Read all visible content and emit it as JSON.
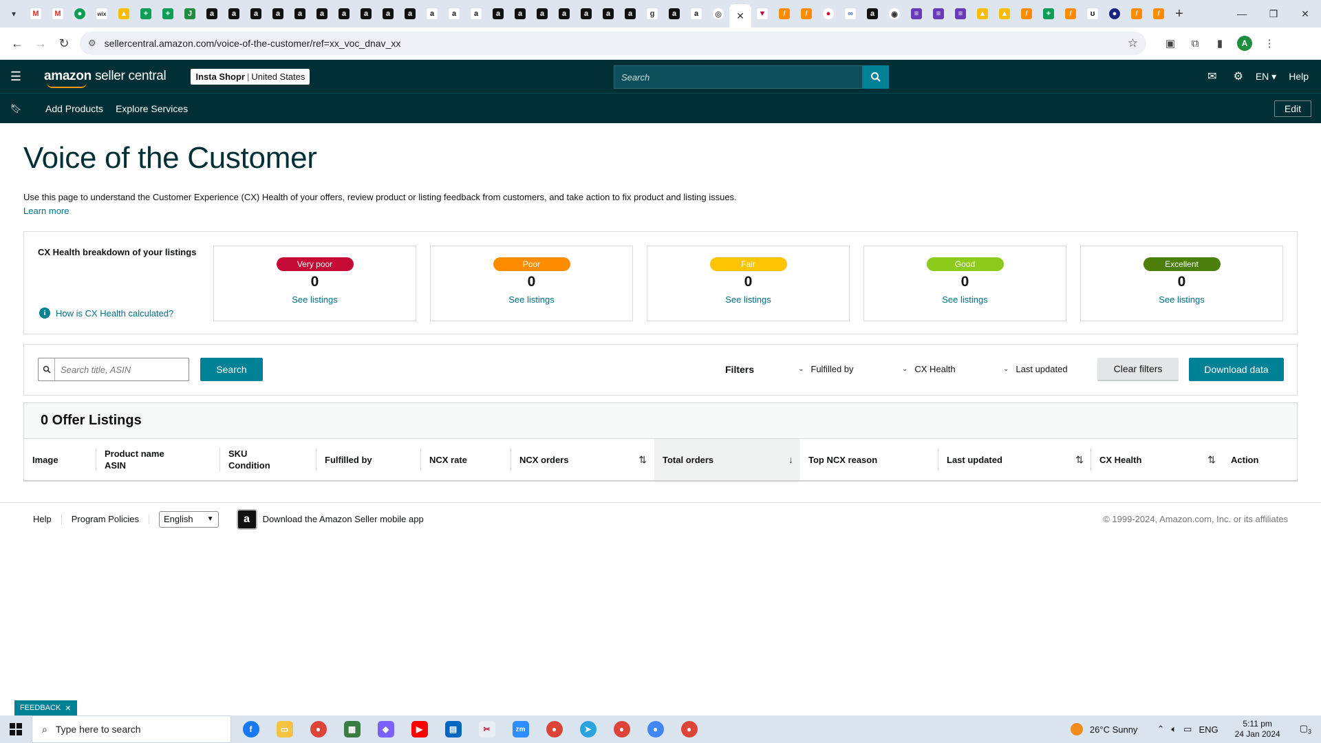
{
  "browser": {
    "url": "sellercentral.amazon.com/voice-of-the-customer/ref=xx_voc_dnav_xx",
    "profile_initial": "A"
  },
  "header": {
    "logo_brand": "amazon",
    "logo_suffix": "seller central",
    "store_name": "Insta Shopr",
    "marketplace": "United States",
    "search_placeholder": "Search",
    "language": "EN",
    "help_label": "Help"
  },
  "subnav": {
    "links": [
      "Add Products",
      "Explore Services"
    ],
    "edit_label": "Edit"
  },
  "page": {
    "title": "Voice of the Customer",
    "intro": "Use this page to understand the Customer Experience (CX) Health of your offers, review product or listing feedback from customers, and take action to fix product and listing issues.",
    "learn_more": "Learn more"
  },
  "cx_health": {
    "title": "CX Health breakdown of your listings",
    "how_link": "How is CX Health calculated?",
    "cards": [
      {
        "label": "Very poor",
        "count": "0",
        "link": "See listings",
        "color": "#c40a35"
      },
      {
        "label": "Poor",
        "count": "0",
        "link": "See listings",
        "color": "#ff8c00"
      },
      {
        "label": "Fair",
        "count": "0",
        "link": "See listings",
        "color": "#ffc400"
      },
      {
        "label": "Good",
        "count": "0",
        "link": "See listings",
        "color": "#8dcb1a"
      },
      {
        "label": "Excellent",
        "count": "0",
        "link": "See listings",
        "color": "#4b7f0a"
      }
    ]
  },
  "filters": {
    "search_placeholder": "Search title, ASIN",
    "search_button": "Search",
    "filters_label": "Filters",
    "dropdowns": [
      "Fulfilled by",
      "CX Health",
      "Last updated"
    ],
    "clear_button": "Clear filters",
    "download_button": "Download data"
  },
  "listings": {
    "heading": "0 Offer Listings",
    "columns": {
      "image": "Image",
      "product_name": "Product name",
      "asin": "ASIN",
      "sku": "SKU",
      "condition": "Condition",
      "fulfilled_by": "Fulfilled by",
      "ncx_rate": "NCX rate",
      "ncx_orders": "NCX orders",
      "total_orders": "Total orders",
      "top_ncx_reason": "Top NCX reason",
      "last_updated": "Last updated",
      "cx_health": "CX Health",
      "action": "Action"
    }
  },
  "footer": {
    "help": "Help",
    "program_policies": "Program Policies",
    "language": "English",
    "app_download": "Download the Amazon Seller mobile app",
    "copyright": "© 1999-2024, Amazon.com, Inc. or its affiliates"
  },
  "feedback_tab": "FEEDBACK",
  "taskbar": {
    "search_placeholder": "Type here to search",
    "weather": "26°C  Sunny",
    "lang": "ENG",
    "time": "5:11 pm",
    "date": "24 Jan 2024",
    "notifications": "3"
  }
}
